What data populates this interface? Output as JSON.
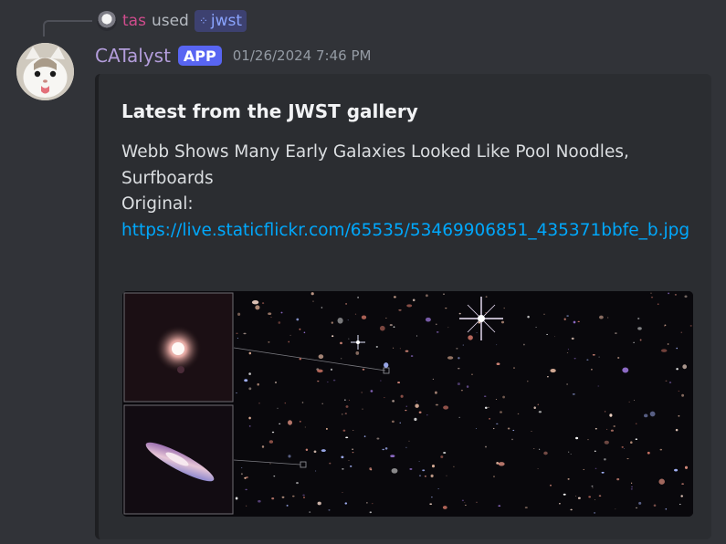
{
  "command": {
    "user": "tas",
    "used_text": "used",
    "slash_name": "jwst"
  },
  "message": {
    "author": "CATalyst",
    "badge": "APP",
    "timestamp": "01/26/2024 7:46 PM"
  },
  "embed": {
    "title": "Latest from the JWST gallery",
    "description_line1": "Webb Shows Many Early Galaxies Looked Like Pool Noodles,",
    "description_line2": "Surfboards",
    "original_label": "Original:",
    "link": "https://live.staticflickr.com/65535/53469906851_435371bbfe_b.jpg"
  },
  "colors": {
    "background": "#313338",
    "embed_bg": "#2b2d31",
    "author": "#b39ddb",
    "app_badge": "#5865f2",
    "link": "#00a8fc",
    "user": "#d04c8d"
  },
  "icons": {
    "command": "slash-command-icon",
    "avatar": "cat-avatar",
    "mini_avatar": "user-avatar"
  }
}
